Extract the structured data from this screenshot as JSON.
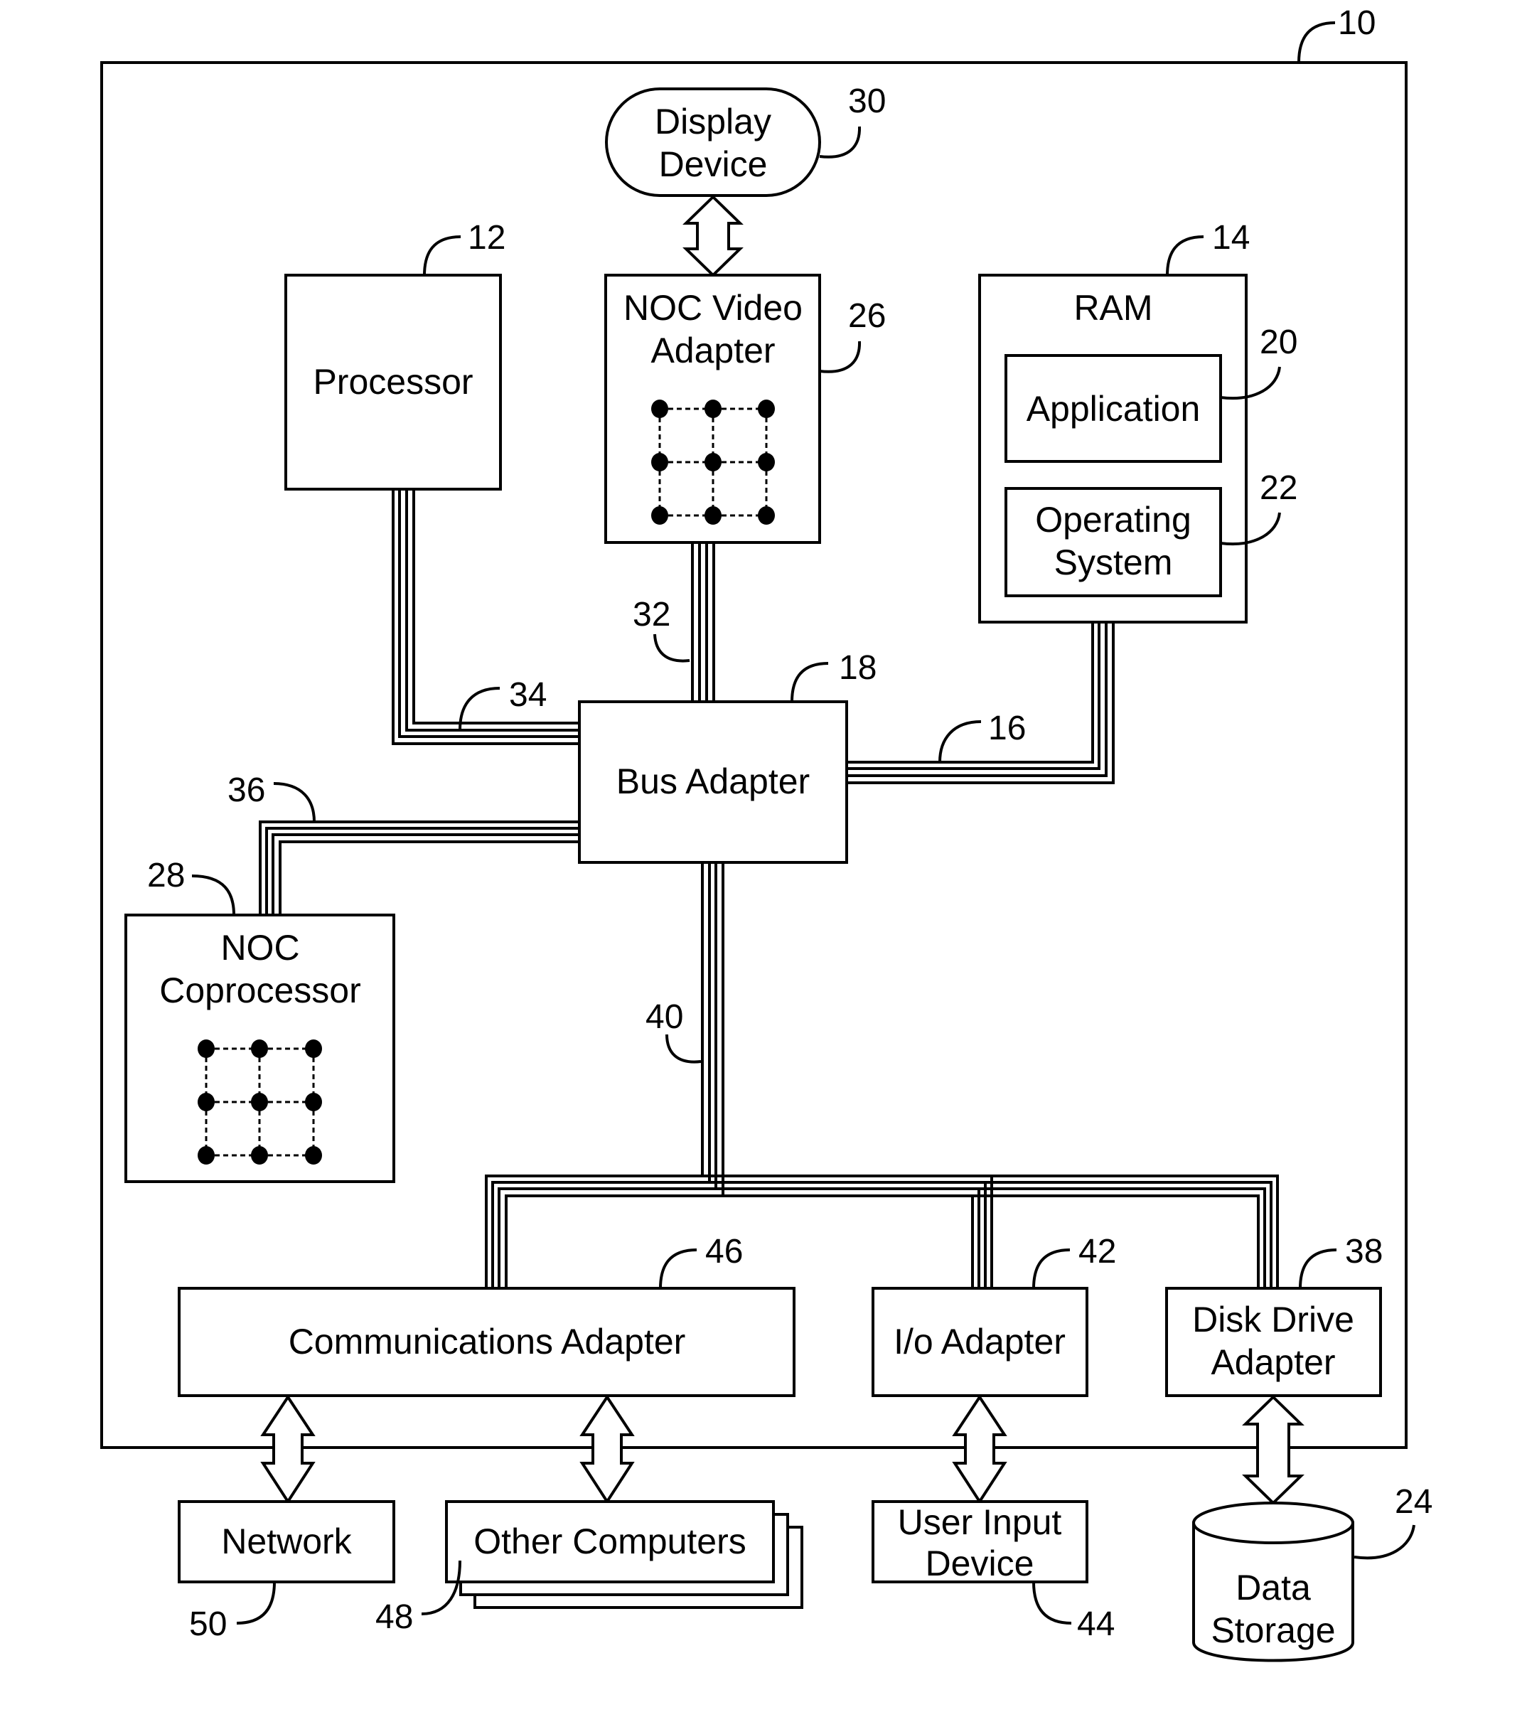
{
  "figure": {
    "system_ref": "10",
    "components": {
      "display_device": {
        "lines": [
          "Display",
          "Device"
        ],
        "ref": "30"
      },
      "processor": {
        "lines": [
          "Processor"
        ],
        "ref": "12"
      },
      "noc_video_adapter": {
        "lines": [
          "NOC Video",
          "Adapter"
        ],
        "ref": "26"
      },
      "ram": {
        "lines": [
          "RAM"
        ],
        "ref": "14"
      },
      "application": {
        "lines": [
          "Application"
        ],
        "ref": "20"
      },
      "operating_system": {
        "lines": [
          "Operating",
          "System"
        ],
        "ref": "22"
      },
      "bus_adapter": {
        "lines": [
          "Bus Adapter"
        ],
        "ref": "18"
      },
      "noc_coprocessor": {
        "lines": [
          "NOC",
          "Coprocessor"
        ],
        "ref": "28"
      },
      "communications_adapter": {
        "lines": [
          "Communications Adapter"
        ],
        "ref": "46"
      },
      "io_adapter": {
        "lines": [
          "I/o Adapter"
        ],
        "ref": "42"
      },
      "disk_drive_adapter": {
        "lines": [
          "Disk Drive",
          "Adapter"
        ],
        "ref": "38"
      },
      "network": {
        "lines": [
          "Network"
        ],
        "ref": "50"
      },
      "other_computers": {
        "lines": [
          "Other Computers"
        ],
        "ref": "48"
      },
      "user_input_device": {
        "lines": [
          "User Input",
          "Device"
        ],
        "ref": "44"
      },
      "data_storage": {
        "lines": [
          "Data",
          "Storage"
        ],
        "ref": "24"
      }
    },
    "buses": {
      "memory_bus": "16",
      "video_bus": "32",
      "front_side_bus": "34",
      "coprocessor_bus": "36",
      "expansion_bus": "40"
    }
  }
}
